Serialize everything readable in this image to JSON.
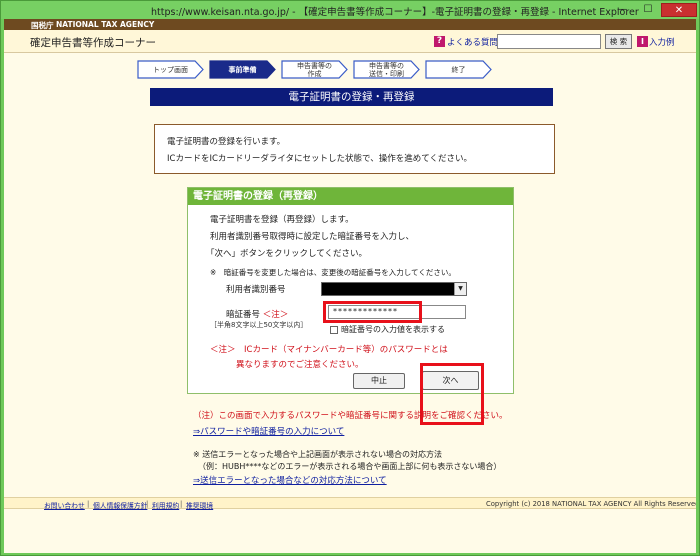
{
  "window": {
    "title": "https://www.keisan.nta.go.jp/ - 【確定申告書等作成コーナー】-電子証明書の登録・再登録 - Internet Explorer",
    "minimize": "—",
    "maximize": "☐",
    "close": "✕"
  },
  "header": {
    "agency_kanji": "国税庁",
    "agency_en": "NATIONAL TAX AGENCY",
    "site_title": "確定申告書等作成コーナー",
    "faq_label": "よくある質問",
    "search_button": "検 索",
    "search_value": "",
    "input_label": "入力例",
    "faq_icon": "?",
    "input_icon": "I"
  },
  "steps": [
    {
      "label": "トップ画面",
      "active": false
    },
    {
      "label": "事前準備",
      "active": true
    },
    {
      "label": "申告書等の\n作成",
      "active": false
    },
    {
      "label": "申告書等の\n送信・印刷",
      "active": false
    },
    {
      "label": "終了",
      "active": false
    }
  ],
  "banner": "電子証明書の登録・再登録",
  "info": {
    "line1": "電子証明書の登録を行います。",
    "line2": "ICカードをICカードリーダライタにセットした状態で、操作を進めてください。"
  },
  "form": {
    "heading": "電子証明書の登録（再登録）",
    "line1": "電子証明書を登録（再登録）します。",
    "line2": "利用者識別番号取得時に設定した暗証番号を入力し、",
    "line3": "「次へ」ボタンをクリックしてください。",
    "notice": "※　暗証番号を変更した場合は、変更後の暗証番号を入力してください。",
    "uid_label": "利用者識別番号",
    "uid_arrow": "▼",
    "pin_label": "暗証番号",
    "pin_note": "＜注＞",
    "pin_sub": "［半角8文字以上50文字以内］",
    "pin_value": "*************",
    "show_pin_label": "暗証番号の入力値を表示する",
    "warn1": "＜注＞　ICカード（マイナンバーカード等）のパスワードとは",
    "warn2": "異なりますのでご注意ください。",
    "cancel_label": "中止",
    "next_label": "次へ"
  },
  "below": {
    "red_note": "（注）この画面で入力するパスワードや暗証番号に関する説明をご確認ください。",
    "link1": "⇒パスワードや暗証番号の入力について",
    "note1": "※ 送信エラーとなった場合や上記画面が表示されない場合の対応方法",
    "note2": "（例：HUBH****などのエラーが表示される場合や画面上部に何も表示さない場合）",
    "link2": "⇒送信エラーとなった場合などの対応方法について"
  },
  "footer": {
    "links": [
      "お問い合わせ",
      "個人情報保護方針",
      "利用規約",
      "推奨環境"
    ],
    "separator": "|",
    "copyright": "Copyright (c) 2018 NATIONAL TAX AGENCY All Rights Reserved."
  },
  "colors": {
    "frame": "#77d063",
    "banner": "#0c1b7a",
    "panel_head": "#6fb53a",
    "highlight": "#e8101a",
    "step_active": "#1a2a8a"
  }
}
